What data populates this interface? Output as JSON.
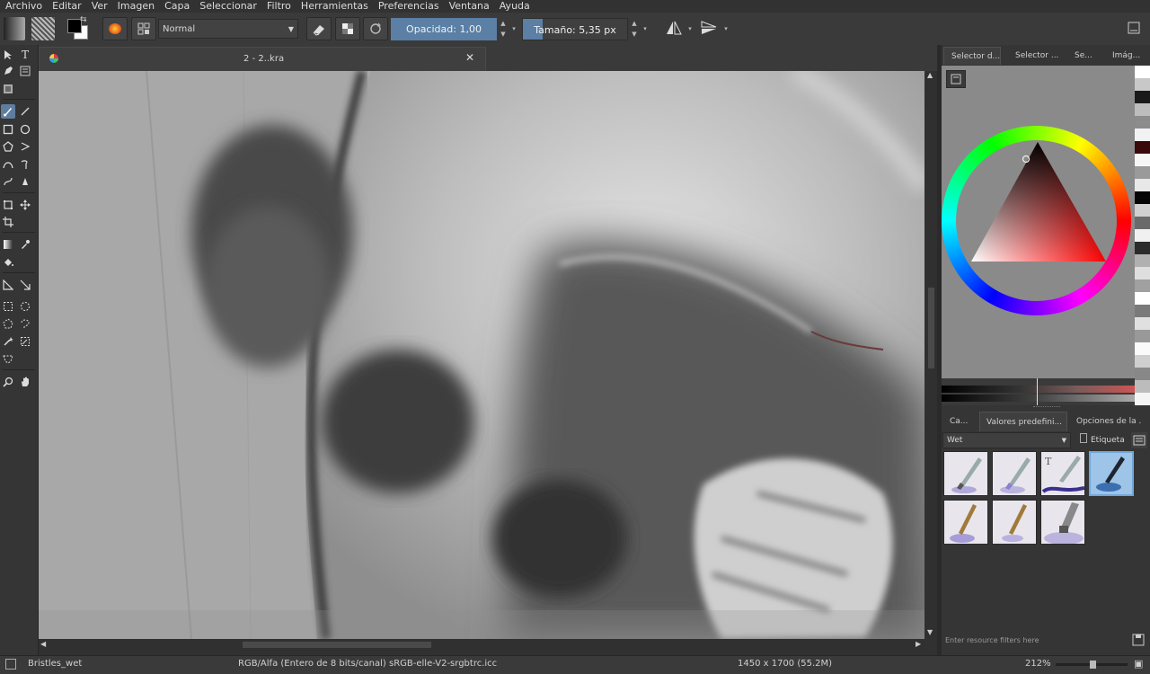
{
  "menu": [
    "Archivo",
    "Editar",
    "Ver",
    "Imagen",
    "Capa",
    "Seleccionar",
    "Filtro",
    "Herramientas",
    "Preferencias",
    "Ventana",
    "Ayuda"
  ],
  "toolbar": {
    "blend_mode": "Normal",
    "opacity_label": "Opacidad:",
    "opacity_value": "1,00",
    "opacity_fraction": 1.0,
    "size_label": "Tamaño:",
    "size_value": "5,35 px"
  },
  "document": {
    "tab_title": "2 - 2..kra"
  },
  "dock": {
    "top_tabs": [
      "Selector d...",
      "Selector ...",
      "Se...",
      "Imág..."
    ],
    "bottom_tabs": [
      "Ca...",
      "Valores predefini...",
      "Opciones de la ..."
    ],
    "preset_tag": "Wet",
    "tag_button": "Etiqueta",
    "filter_placeholder": "Enter resource filters here"
  },
  "status": {
    "preset_name": "Bristles_wet",
    "color_space": "RGB/Alfa (Entero de 8 bits/canal)  sRGB-elle-V2-srgbtrc.icc",
    "dimensions": "1450 x 1700 (55.2M)",
    "zoom": "212%"
  },
  "colors": {
    "accent": "#5b7fa5",
    "selection": "#6fa8dc",
    "swatches": [
      "#ffffff",
      "#c8c8c8",
      "#1a1a1a",
      "#bdbdbd",
      "#8c8c8c",
      "#f2f2f2",
      "#3a0a0a",
      "#f6f6f6",
      "#9a9a9a",
      "#e8e8e8",
      "#050505",
      "#d0d0d0",
      "#6a6a6a",
      "#f0f0f0",
      "#2b2b2b",
      "#b0b0b0",
      "#dedede",
      "#a0a0a0",
      "#ffffff",
      "#7a7a7a",
      "#e0e0e0",
      "#999999",
      "#fafafa",
      "#cfcfcf",
      "#888888",
      "#bcbcbc",
      "#f4f4f4"
    ]
  }
}
